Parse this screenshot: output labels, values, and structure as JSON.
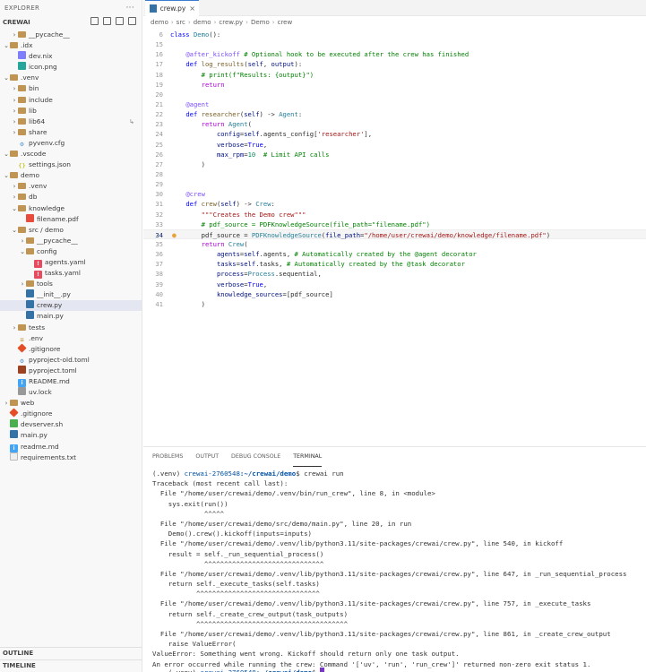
{
  "sidebar": {
    "title": "EXPLORER",
    "more": "···",
    "root": "CREWAI",
    "tree": [
      {
        "depth": 1,
        "chev": "›",
        "icon": "folder",
        "label": "__pycache__"
      },
      {
        "depth": 0,
        "chev": "⌄",
        "icon": "folder",
        "label": ".idx"
      },
      {
        "depth": 1,
        "chev": "",
        "icon": "nix",
        "label": "dev.nix"
      },
      {
        "depth": 1,
        "chev": "",
        "icon": "png",
        "label": "icon.png"
      },
      {
        "depth": 0,
        "chev": "⌄",
        "icon": "folder",
        "label": ".venv"
      },
      {
        "depth": 1,
        "chev": "›",
        "icon": "folder",
        "label": "bin"
      },
      {
        "depth": 1,
        "chev": "›",
        "icon": "folder",
        "label": "include"
      },
      {
        "depth": 1,
        "chev": "›",
        "icon": "folder",
        "label": "lib"
      },
      {
        "depth": 1,
        "chev": "›",
        "icon": "folder",
        "label": "lib64",
        "badge": "↳"
      },
      {
        "depth": 1,
        "chev": "›",
        "icon": "folder",
        "label": "share"
      },
      {
        "depth": 1,
        "chev": "",
        "icon": "gear",
        "label": "pyvenv.cfg"
      },
      {
        "depth": 0,
        "chev": "⌄",
        "icon": "folder",
        "label": ".vscode"
      },
      {
        "depth": 1,
        "chev": "",
        "icon": "json",
        "label": "settings.json"
      },
      {
        "depth": 0,
        "chev": "⌄",
        "icon": "folder",
        "label": "demo"
      },
      {
        "depth": 1,
        "chev": "›",
        "icon": "folder",
        "label": ".venv"
      },
      {
        "depth": 1,
        "chev": "›",
        "icon": "folder",
        "label": "db"
      },
      {
        "depth": 1,
        "chev": "⌄",
        "icon": "folder",
        "label": "knowledge"
      },
      {
        "depth": 2,
        "chev": "",
        "icon": "pdf",
        "label": "filename.pdf"
      },
      {
        "depth": 1,
        "chev": "⌄",
        "icon": "folder",
        "label": "src / demo"
      },
      {
        "depth": 2,
        "chev": "›",
        "icon": "folder",
        "label": "__pycache__"
      },
      {
        "depth": 2,
        "chev": "⌄",
        "icon": "folder",
        "label": "config"
      },
      {
        "depth": 3,
        "chev": "",
        "icon": "yaml",
        "label": "agents.yaml"
      },
      {
        "depth": 3,
        "chev": "",
        "icon": "yaml",
        "label": "tasks.yaml"
      },
      {
        "depth": 2,
        "chev": "›",
        "icon": "folder",
        "label": "tools"
      },
      {
        "depth": 2,
        "chev": "",
        "icon": "py",
        "label": "__init__.py"
      },
      {
        "depth": 2,
        "chev": "",
        "icon": "py",
        "label": "crew.py",
        "selected": true
      },
      {
        "depth": 2,
        "chev": "",
        "icon": "py",
        "label": "main.py"
      },
      {
        "depth": 1,
        "chev": "›",
        "icon": "folder",
        "label": "tests"
      },
      {
        "depth": 1,
        "chev": "",
        "icon": "env",
        "label": ".env"
      },
      {
        "depth": 1,
        "chev": "",
        "icon": "git",
        "label": ".gitignore"
      },
      {
        "depth": 1,
        "chev": "",
        "icon": "gear",
        "label": "pyproject-old.toml"
      },
      {
        "depth": 1,
        "chev": "",
        "icon": "toml",
        "label": "pyproject.toml"
      },
      {
        "depth": 1,
        "chev": "",
        "icon": "info",
        "label": "README.md"
      },
      {
        "depth": 1,
        "chev": "",
        "icon": "lock",
        "label": "uv.lock"
      },
      {
        "depth": 0,
        "chev": "›",
        "icon": "folder",
        "label": "web"
      },
      {
        "depth": 0,
        "chev": "",
        "icon": "git",
        "label": ".gitignore"
      },
      {
        "depth": 0,
        "chev": "",
        "icon": "sh",
        "label": "devserver.sh"
      },
      {
        "depth": 0,
        "chev": "",
        "icon": "py",
        "label": "main.py"
      },
      {
        "depth": 0,
        "chev": "",
        "icon": "info",
        "label": "readme.md"
      },
      {
        "depth": 0,
        "chev": "",
        "icon": "txt",
        "label": "requirements.txt"
      }
    ],
    "outline": "OUTLINE",
    "timeline": "TIMELINE"
  },
  "editor": {
    "tab_label": "crew.py",
    "tab_close": "×",
    "breadcrumb": [
      "demo",
      "src",
      "demo",
      "crew.py",
      "Demo",
      "crew"
    ],
    "lines": [
      {
        "n": "6",
        "html": "<span class=\"kw\">class</span> <span class=\"cls\">Demo</span>():"
      },
      {
        "n": "15",
        "html": ""
      },
      {
        "n": "16",
        "html": "    <span class=\"dec\">@after_kickoff</span> <span class=\"cm\"># Optional hook to be executed after the crew has finished</span>"
      },
      {
        "n": "17",
        "html": "    <span class=\"kw\">def</span> <span class=\"fn\">log_results</span>(<span class=\"param\">self</span>, <span class=\"param\">output</span>):"
      },
      {
        "n": "18",
        "html": "        <span class=\"cm\"># print(f\"Results: {output}\")</span>"
      },
      {
        "n": "19",
        "html": "        <span class=\"kw2\">return</span>"
      },
      {
        "n": "20",
        "html": ""
      },
      {
        "n": "21",
        "html": "    <span class=\"dec\">@agent</span>"
      },
      {
        "n": "22",
        "html": "    <span class=\"kw\">def</span> <span class=\"fn\">researcher</span>(<span class=\"param\">self</span>) -> <span class=\"cls\">Agent</span>:"
      },
      {
        "n": "23",
        "html": "        <span class=\"kw2\">return</span> <span class=\"cls\">Agent</span>("
      },
      {
        "n": "24",
        "html": "            <span class=\"param\">config</span>=<span class=\"param\">self</span>.agents_config[<span class=\"str\">'researcher'</span>],"
      },
      {
        "n": "25",
        "html": "            <span class=\"param\">verbose</span>=<span class=\"kw\">True</span>,"
      },
      {
        "n": "26",
        "html": "            <span class=\"param\">max_rpm</span>=<span class=\"num\">10</span>  <span class=\"cm\"># Limit API calls</span>"
      },
      {
        "n": "27",
        "html": "        )"
      },
      {
        "n": "28",
        "html": ""
      },
      {
        "n": "29",
        "html": ""
      },
      {
        "n": "30",
        "html": "    <span class=\"dec\">@crew</span>"
      },
      {
        "n": "31",
        "html": "    <span class=\"kw\">def</span> <span class=\"fn\">crew</span>(<span class=\"param\">self</span>) -> <span class=\"cls\">Crew</span>:"
      },
      {
        "n": "32",
        "html": "        <span class=\"str\">\"\"\"Creates the Demo crew\"\"\"</span>"
      },
      {
        "n": "33",
        "html": "        <span class=\"cm\"># pdf_source = PDFKnowledgeSource(file_path=\"filename.pdf\")</span>"
      },
      {
        "n": "34",
        "html": "        pdf_source = <span class=\"cls\">PDFKnowledgeSource</span>(<span class=\"param\">file_path</span>=<span class=\"str\">\"/home/user/crewai/demo/knowledge/filename.pdf\"</span>)",
        "current": true
      },
      {
        "n": "35",
        "html": "        <span class=\"kw2\">return</span> <span class=\"cls\">Crew</span>("
      },
      {
        "n": "36",
        "html": "            <span class=\"param\">agents</span>=<span class=\"param\">self</span>.agents, <span class=\"cm\"># Automatically created by the @agent decorator</span>"
      },
      {
        "n": "37",
        "html": "            <span class=\"param\">tasks</span>=<span class=\"param\">self</span>.tasks, <span class=\"cm\"># Automatically created by the @task decorator</span>"
      },
      {
        "n": "38",
        "html": "            <span class=\"param\">process</span>=<span class=\"cls\">Process</span>.sequential,"
      },
      {
        "n": "39",
        "html": "            <span class=\"param\">verbose</span>=<span class=\"kw\">True</span>,"
      },
      {
        "n": "40",
        "html": "            <span class=\"param\">knowledge_sources</span>=[pdf_source]"
      },
      {
        "n": "41",
        "html": "        )"
      }
    ]
  },
  "panel": {
    "tabs": [
      "PROBLEMS",
      "OUTPUT",
      "DEBUG CONSOLE",
      "TERMINAL"
    ],
    "active_tab": "TERMINAL",
    "prompt_prefix": "(.venv) ",
    "prompt_host": "crewai-2760548",
    "prompt_path": ":~/crewai/demo",
    "prompt_suffix": "$ ",
    "command": "crewai run",
    "output": [
      "Traceback (most recent call last):",
      "  File \"/home/user/crewai/demo/.venv/bin/run_crew\", line 8, in <module>",
      "    sys.exit(run())",
      "             ^^^^^",
      "  File \"/home/user/crewai/demo/src/demo/main.py\", line 20, in run",
      "    Demo().crew().kickoff(inputs=inputs)",
      "  File \"/home/user/crewai/demo/.venv/lib/python3.11/site-packages/crewai/crew.py\", line 540, in kickoff",
      "    result = self._run_sequential_process()",
      "             ^^^^^^^^^^^^^^^^^^^^^^^^^^^^^^",
      "  File \"/home/user/crewai/demo/.venv/lib/python3.11/site-packages/crewai/crew.py\", line 647, in _run_sequential_process",
      "    return self._execute_tasks(self.tasks)",
      "           ^^^^^^^^^^^^^^^^^^^^^^^^^^^^^^^",
      "  File \"/home/user/crewai/demo/.venv/lib/python3.11/site-packages/crewai/crew.py\", line 757, in _execute_tasks",
      "    return self._create_crew_output(task_outputs)",
      "           ^^^^^^^^^^^^^^^^^^^^^^^^^^^^^^^^^^^^^^",
      "  File \"/home/user/crewai/demo/.venv/lib/python3.11/site-packages/crewai/crew.py\", line 861, in _create_crew_output",
      "    raise ValueError(",
      "ValueError: Something went wrong. Kickoff should return only one task output.",
      "An error occurred while running the crew: Command '['uv', 'run', 'run_crew']' returned non-zero exit status 1."
    ]
  }
}
